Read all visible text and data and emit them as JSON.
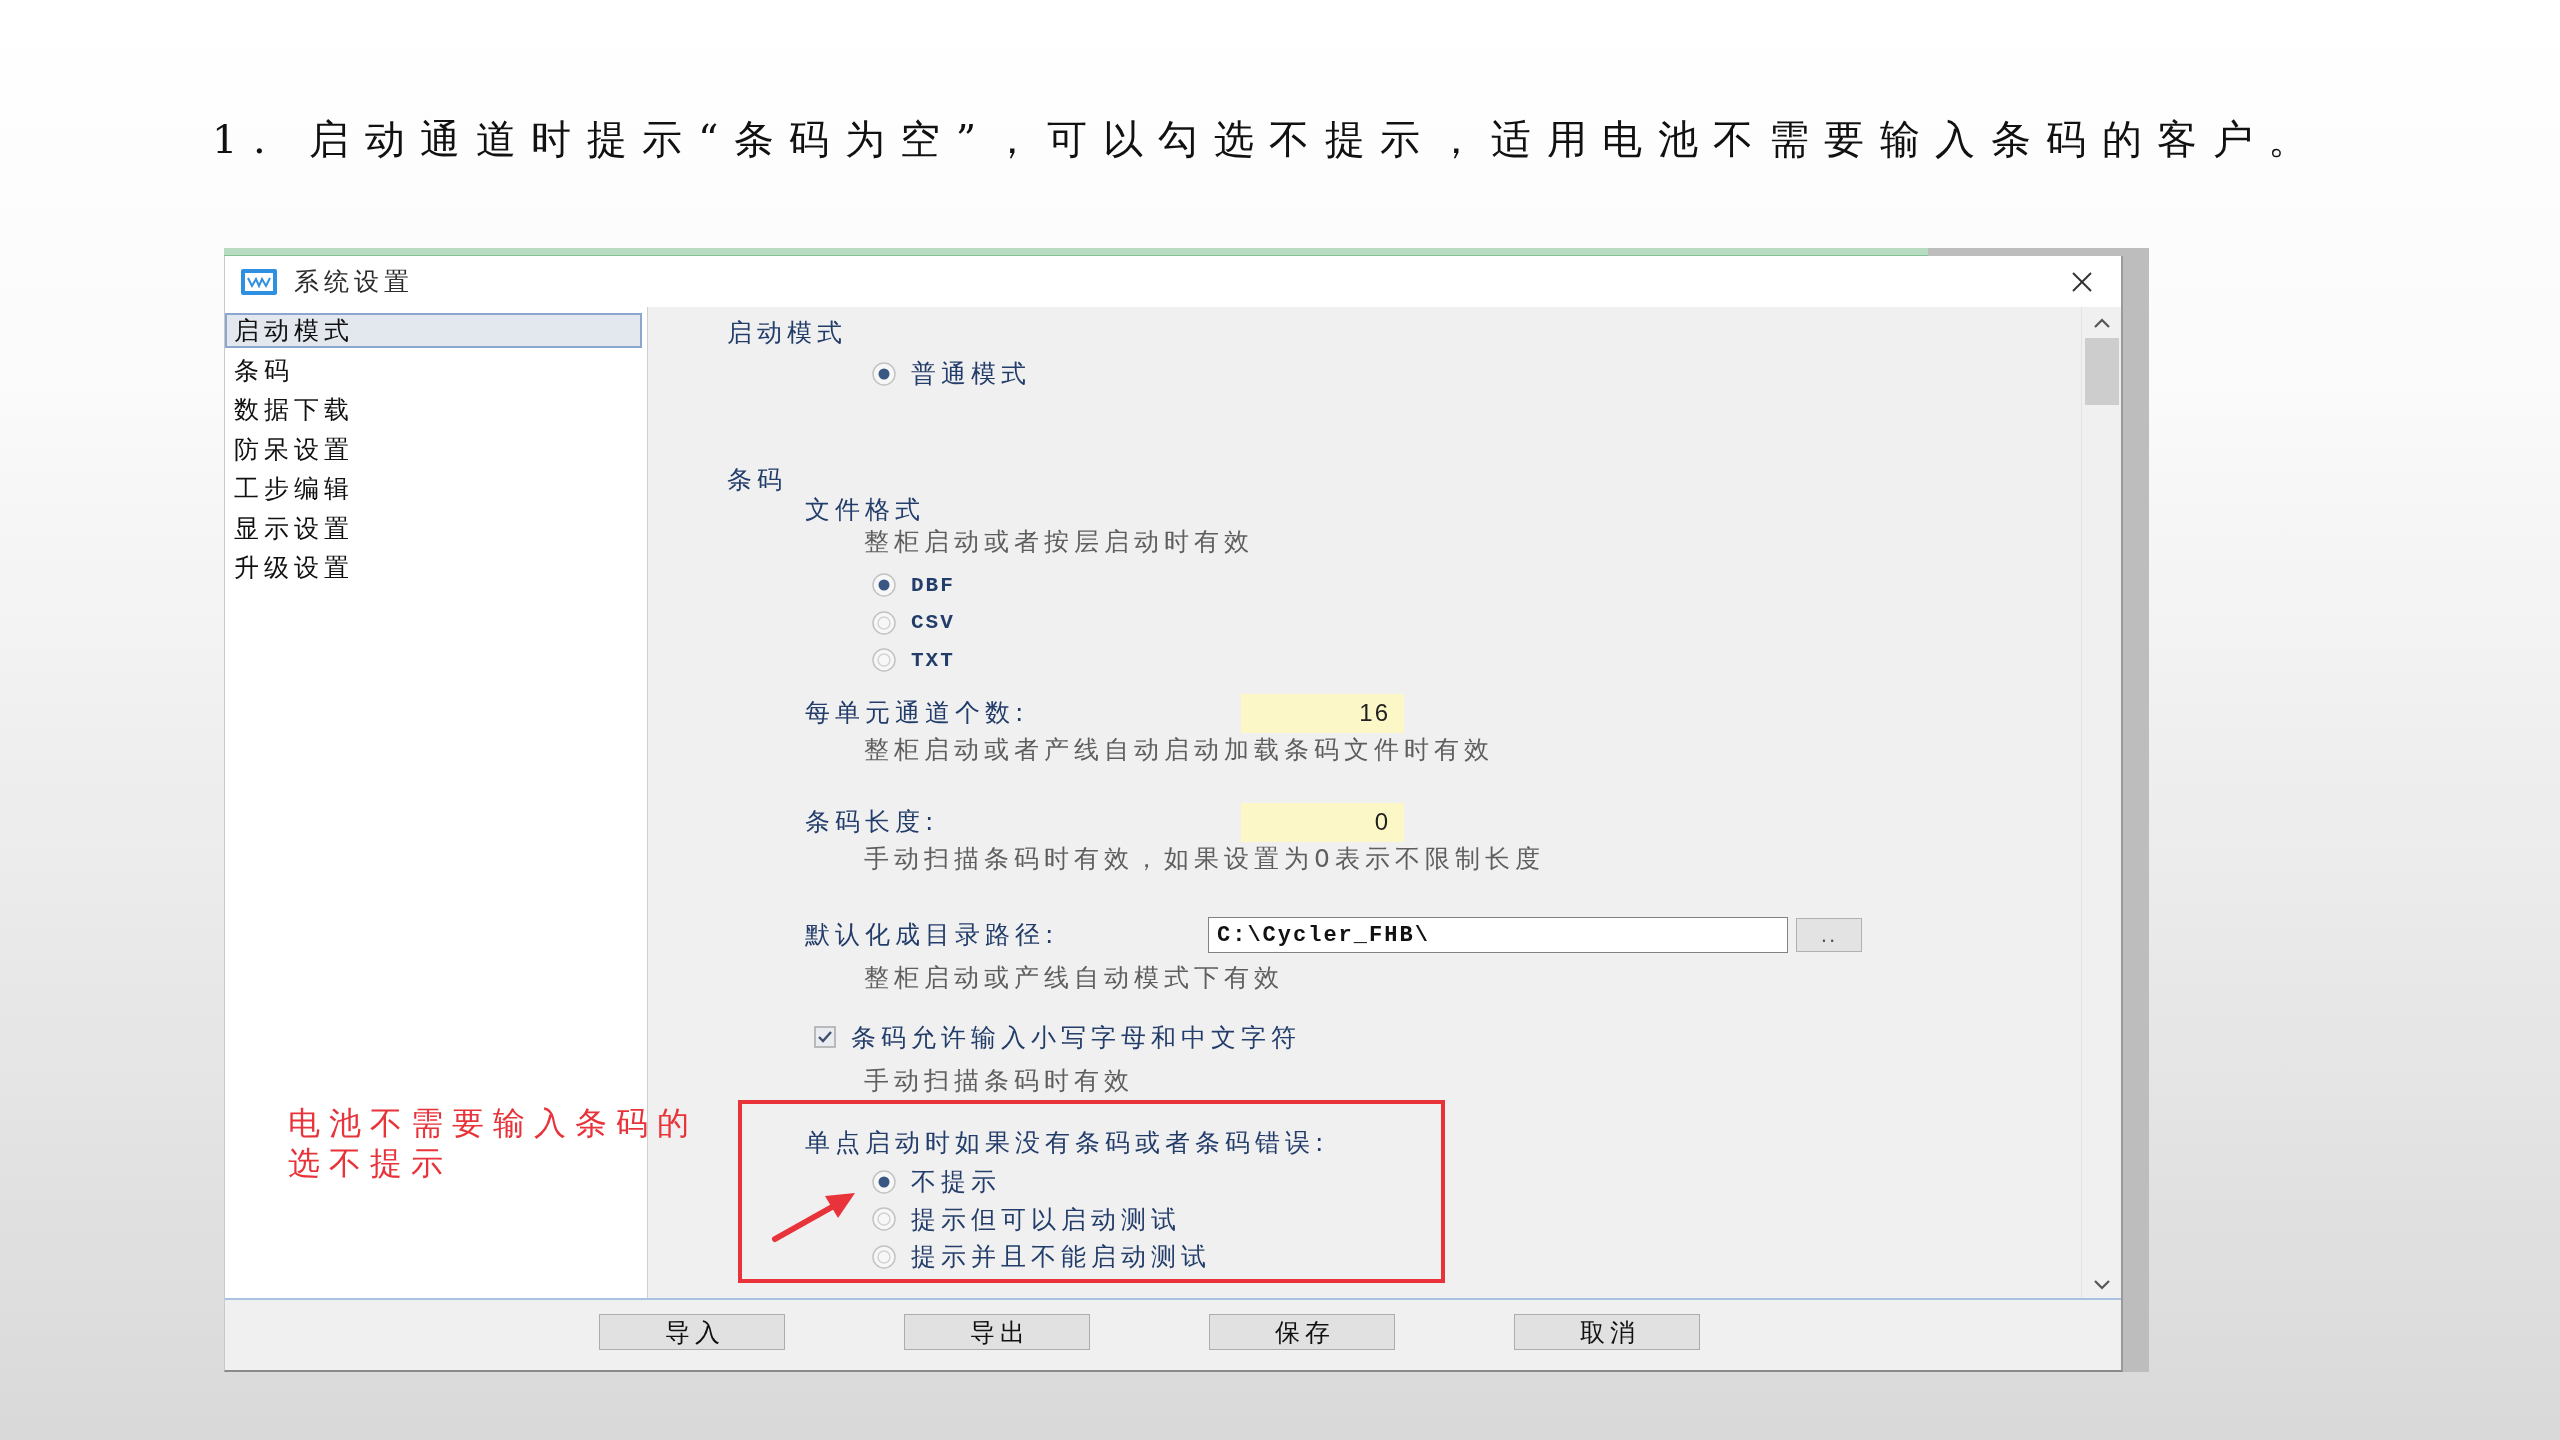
{
  "heading": "1. 启动通道时提示“条码为空”，可以勾选不提示，适用电池不需要输入条码的客户。",
  "dialog": {
    "title": "系统设置",
    "sidebar": {
      "items": [
        {
          "label": "启动模式",
          "selected": true
        },
        {
          "label": "条码",
          "selected": false
        },
        {
          "label": "数据下载",
          "selected": false
        },
        {
          "label": "防呆设置",
          "selected": false
        },
        {
          "label": "工步编辑",
          "selected": false
        },
        {
          "label": "显示设置",
          "selected": false
        },
        {
          "label": "升级设置",
          "selected": false
        }
      ]
    },
    "content": [
      {
        "kind": "section",
        "label": "启动模式"
      },
      {
        "kind": "radios",
        "options": [
          {
            "label": "普通模式",
            "selected": true
          }
        ]
      },
      {
        "kind": "section",
        "label": "条码"
      },
      {
        "kind": "subheading",
        "label": "文件格式"
      },
      {
        "kind": "hint",
        "text": "整柜启动或者按层启动时有效"
      },
      {
        "kind": "filetypes",
        "options": [
          {
            "label": "DBF",
            "selected": true
          },
          {
            "label": "CSV",
            "selected": false
          },
          {
            "label": "TXT",
            "selected": false
          }
        ]
      },
      {
        "kind": "number",
        "label": "每单元通道个数:",
        "value": "16"
      },
      {
        "kind": "hint",
        "text": "整柜启动或者产线自动启动加载条码文件时有效"
      },
      {
        "kind": "number",
        "label": "条码长度:",
        "value": "0"
      },
      {
        "kind": "hint",
        "text": "手动扫描条码时有效，如果设置为0表示不限制长度"
      },
      {
        "kind": "path",
        "label": "默认化成目录路径:",
        "value": "C:\\Cycler_FHB\\",
        "button": ".."
      },
      {
        "kind": "hint",
        "text": "整柜启动或产线自动模式下有效"
      },
      {
        "kind": "checkbox",
        "label": "条码允许输入小写字母和中文字符",
        "checked": true
      },
      {
        "kind": "hint",
        "text": "手动扫描条码时有效"
      },
      {
        "kind": "prompt",
        "label": "单点启动时如果没有条码或者条码错误:",
        "highlighted": true,
        "options": [
          {
            "label": "不提示",
            "selected": true
          },
          {
            "label": "提示但可以启动测试",
            "selected": false
          },
          {
            "label": "提示并且不能启动测试",
            "selected": false
          }
        ]
      }
    ],
    "buttons": [
      "导入",
      "导出",
      "保存",
      "取消"
    ]
  },
  "annotation": {
    "text": "电池不需要输入条码的选不提示"
  }
}
